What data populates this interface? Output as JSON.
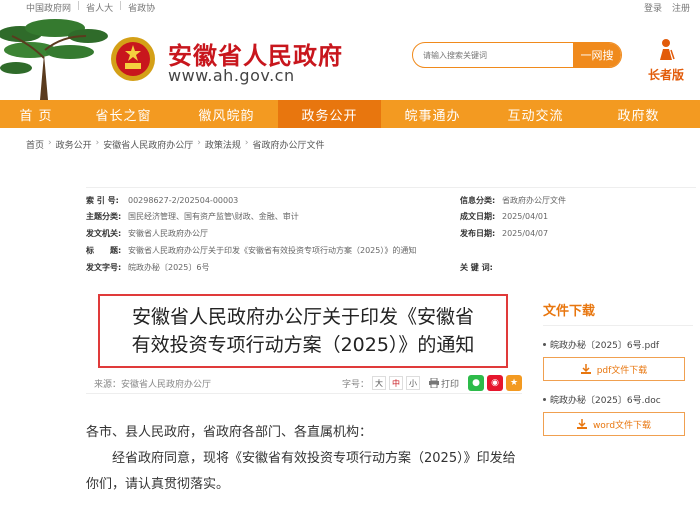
{
  "topbar": {
    "links": [
      "中国政府网",
      "省人大",
      "省政协"
    ],
    "right": [
      "登录",
      "注册"
    ]
  },
  "header": {
    "site_title": "安徽省人民政府",
    "site_url": "www.ah.gov.cn",
    "search_placeholder": "请输入搜索关键词",
    "search_button": "一网搜",
    "elder_label": "长者版"
  },
  "nav": {
    "items": [
      "首 页",
      "省长之窗",
      "徽风皖韵",
      "政务公开",
      "皖事通办",
      "互动交流",
      "政府数"
    ],
    "active_index": 3
  },
  "breadcrumb": [
    "首页",
    "政务公开",
    "安徽省人民政府办公厅",
    "政策法规",
    "省政府办公厅文件"
  ],
  "meta": {
    "left": [
      {
        "k": "索 引 号:",
        "v": "00298627-2/202504-00003"
      },
      {
        "k": "主题分类:",
        "v": "国民经济管理、国有资产监管\\财政、金融、审计"
      },
      {
        "k": "发文机关:",
        "v": "安徽省人民政府办公厅"
      },
      {
        "k": "标　　题:",
        "v": "安徽省人民政府办公厅关于印发《安徽省有效投资专项行动方案（2025）》的通知"
      },
      {
        "k": "发文字号:",
        "v": "皖政办秘〔2025〕6号"
      }
    ],
    "right": [
      {
        "k": "信息分类:",
        "v": "省政府办公厅文件"
      },
      {
        "k": "成文日期:",
        "v": "2025/04/01"
      },
      {
        "k": "发布日期:",
        "v": "2025/04/07"
      },
      {
        "k": "关 键 词:",
        "v": ""
      }
    ]
  },
  "doc": {
    "title_line1": "安徽省人民政府办公厅关于印发《安徽省",
    "title_line2": "有效投资专项行动方案（2025）》的通知",
    "source": "来源：安徽省人民政府办公厅",
    "font_size_label": "字号：",
    "font_sizes": [
      "大",
      "中",
      "小"
    ],
    "print_label": "打印",
    "salutation": "各市、县人民政府，省政府各部门、各直属机构：",
    "para1": "经省政府同意，现将《安徽省有效投资专项行动方案（2025）》印发给你们，请认真贯彻落实。"
  },
  "downloads": {
    "title": "文件下载",
    "files": [
      {
        "name": "皖政办秘〔2025〕6号.pdf",
        "button": "pdf文件下载"
      },
      {
        "name": "皖政办秘〔2025〕6号.doc",
        "button": "word文件下载"
      }
    ]
  },
  "colors": {
    "accent": "#f39a21",
    "accent_dark": "#e8760e",
    "brand_red": "#c8161d",
    "title_border": "#e03a3a"
  },
  "icons": [
    "pine-tree-icon",
    "national-emblem-icon",
    "elder-person-icon",
    "printer-icon",
    "wechat-icon",
    "weibo-icon",
    "favorite-icon",
    "download-icon"
  ]
}
